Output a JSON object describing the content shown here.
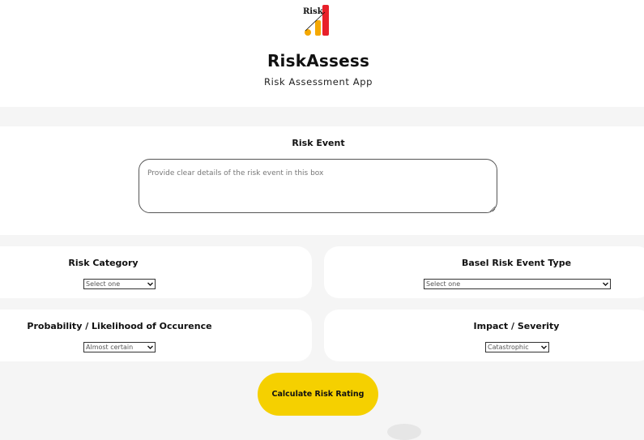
{
  "app": {
    "logo_text": "Risk",
    "title": "RiskAssess",
    "subtitle": "Risk Assessment App"
  },
  "risk_event": {
    "label": "Risk Event",
    "placeholder": "Provide clear details of the risk event in this box"
  },
  "risk_category": {
    "label": "Risk Category",
    "selected": "Select one"
  },
  "basel_type": {
    "label": "Basel Risk Event Type",
    "selected": "Select one"
  },
  "probability": {
    "label": "Probability / Likelihood of Occurence",
    "selected": "Almost certain"
  },
  "impact": {
    "label": "Impact / Severity",
    "selected": "Catastrophic"
  },
  "actions": {
    "calculate_label": "Calculate Risk Rating"
  },
  "colors": {
    "accent": "#f5d000",
    "logo_red": "#e8202a",
    "logo_orange": "#f5a800",
    "background": "#f5f5f5"
  }
}
